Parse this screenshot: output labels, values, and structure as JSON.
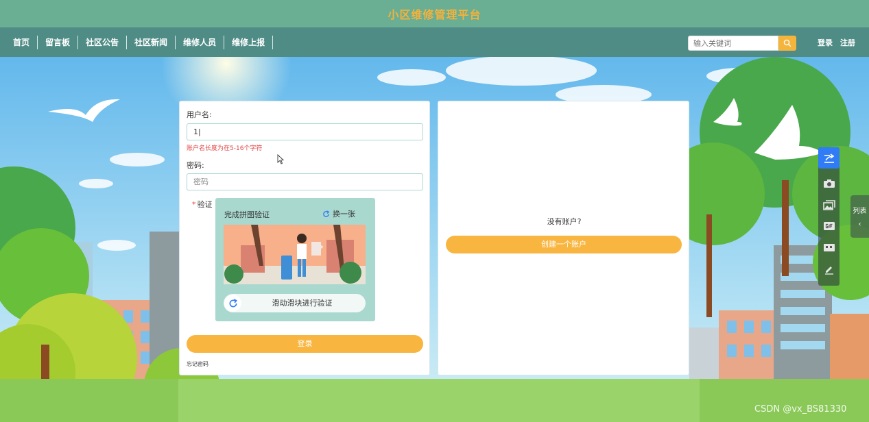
{
  "header": {
    "title": "小区维修管理平台"
  },
  "nav": {
    "items": [
      "首页",
      "留言板",
      "社区公告",
      "社区新闻",
      "维修人员",
      "维修上报"
    ],
    "search_placeholder": "输入关键词",
    "login": "登录",
    "register": "注册"
  },
  "login_form": {
    "username_label": "用户名:",
    "username_value": "1|",
    "username_error": "账户名长度为在5-16个字符",
    "password_label": "密码:",
    "password_placeholder": "密码",
    "verify_required_mark": "*",
    "verify_label": "验证",
    "puzzle_title": "完成拼图验证",
    "puzzle_refresh": "换一张",
    "slider_text": "滑动滑块进行验证",
    "login_button": "登录",
    "forgot_password": "忘记密码"
  },
  "register_panel": {
    "no_account": "没有账户?",
    "create_button": "创建一个账户"
  },
  "float_toolbar": {
    "list_tab": "列表"
  },
  "watermark": "CSDN @vx_BS81330",
  "colors": {
    "title_bar": "#6aae94",
    "nav_bar": "#4f8c86",
    "accent": "#f8b641",
    "error": "#e04848"
  }
}
